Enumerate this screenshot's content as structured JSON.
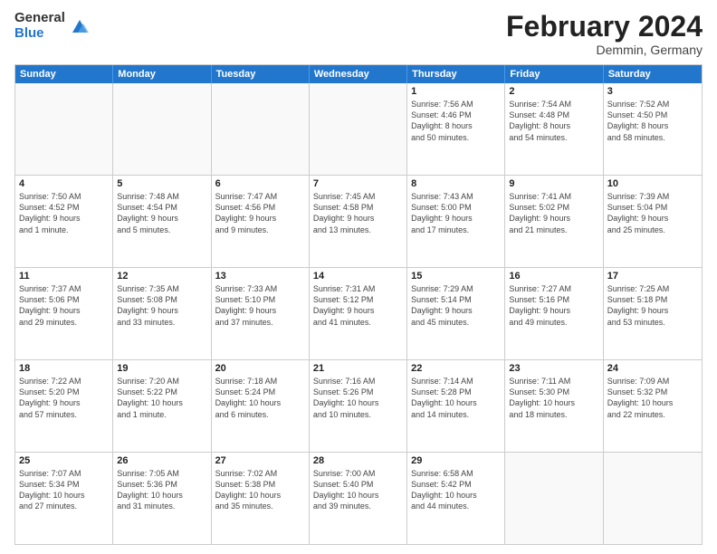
{
  "header": {
    "logo": {
      "general": "General",
      "blue": "Blue"
    },
    "title": "February 2024",
    "location": "Demmin, Germany"
  },
  "weekdays": [
    "Sunday",
    "Monday",
    "Tuesday",
    "Wednesday",
    "Thursday",
    "Friday",
    "Saturday"
  ],
  "rows": [
    [
      {
        "day": "",
        "info": ""
      },
      {
        "day": "",
        "info": ""
      },
      {
        "day": "",
        "info": ""
      },
      {
        "day": "",
        "info": ""
      },
      {
        "day": "1",
        "info": "Sunrise: 7:56 AM\nSunset: 4:46 PM\nDaylight: 8 hours\nand 50 minutes."
      },
      {
        "day": "2",
        "info": "Sunrise: 7:54 AM\nSunset: 4:48 PM\nDaylight: 8 hours\nand 54 minutes."
      },
      {
        "day": "3",
        "info": "Sunrise: 7:52 AM\nSunset: 4:50 PM\nDaylight: 8 hours\nand 58 minutes."
      }
    ],
    [
      {
        "day": "4",
        "info": "Sunrise: 7:50 AM\nSunset: 4:52 PM\nDaylight: 9 hours\nand 1 minute."
      },
      {
        "day": "5",
        "info": "Sunrise: 7:48 AM\nSunset: 4:54 PM\nDaylight: 9 hours\nand 5 minutes."
      },
      {
        "day": "6",
        "info": "Sunrise: 7:47 AM\nSunset: 4:56 PM\nDaylight: 9 hours\nand 9 minutes."
      },
      {
        "day": "7",
        "info": "Sunrise: 7:45 AM\nSunset: 4:58 PM\nDaylight: 9 hours\nand 13 minutes."
      },
      {
        "day": "8",
        "info": "Sunrise: 7:43 AM\nSunset: 5:00 PM\nDaylight: 9 hours\nand 17 minutes."
      },
      {
        "day": "9",
        "info": "Sunrise: 7:41 AM\nSunset: 5:02 PM\nDaylight: 9 hours\nand 21 minutes."
      },
      {
        "day": "10",
        "info": "Sunrise: 7:39 AM\nSunset: 5:04 PM\nDaylight: 9 hours\nand 25 minutes."
      }
    ],
    [
      {
        "day": "11",
        "info": "Sunrise: 7:37 AM\nSunset: 5:06 PM\nDaylight: 9 hours\nand 29 minutes."
      },
      {
        "day": "12",
        "info": "Sunrise: 7:35 AM\nSunset: 5:08 PM\nDaylight: 9 hours\nand 33 minutes."
      },
      {
        "day": "13",
        "info": "Sunrise: 7:33 AM\nSunset: 5:10 PM\nDaylight: 9 hours\nand 37 minutes."
      },
      {
        "day": "14",
        "info": "Sunrise: 7:31 AM\nSunset: 5:12 PM\nDaylight: 9 hours\nand 41 minutes."
      },
      {
        "day": "15",
        "info": "Sunrise: 7:29 AM\nSunset: 5:14 PM\nDaylight: 9 hours\nand 45 minutes."
      },
      {
        "day": "16",
        "info": "Sunrise: 7:27 AM\nSunset: 5:16 PM\nDaylight: 9 hours\nand 49 minutes."
      },
      {
        "day": "17",
        "info": "Sunrise: 7:25 AM\nSunset: 5:18 PM\nDaylight: 9 hours\nand 53 minutes."
      }
    ],
    [
      {
        "day": "18",
        "info": "Sunrise: 7:22 AM\nSunset: 5:20 PM\nDaylight: 9 hours\nand 57 minutes."
      },
      {
        "day": "19",
        "info": "Sunrise: 7:20 AM\nSunset: 5:22 PM\nDaylight: 10 hours\nand 1 minute."
      },
      {
        "day": "20",
        "info": "Sunrise: 7:18 AM\nSunset: 5:24 PM\nDaylight: 10 hours\nand 6 minutes."
      },
      {
        "day": "21",
        "info": "Sunrise: 7:16 AM\nSunset: 5:26 PM\nDaylight: 10 hours\nand 10 minutes."
      },
      {
        "day": "22",
        "info": "Sunrise: 7:14 AM\nSunset: 5:28 PM\nDaylight: 10 hours\nand 14 minutes."
      },
      {
        "day": "23",
        "info": "Sunrise: 7:11 AM\nSunset: 5:30 PM\nDaylight: 10 hours\nand 18 minutes."
      },
      {
        "day": "24",
        "info": "Sunrise: 7:09 AM\nSunset: 5:32 PM\nDaylight: 10 hours\nand 22 minutes."
      }
    ],
    [
      {
        "day": "25",
        "info": "Sunrise: 7:07 AM\nSunset: 5:34 PM\nDaylight: 10 hours\nand 27 minutes."
      },
      {
        "day": "26",
        "info": "Sunrise: 7:05 AM\nSunset: 5:36 PM\nDaylight: 10 hours\nand 31 minutes."
      },
      {
        "day": "27",
        "info": "Sunrise: 7:02 AM\nSunset: 5:38 PM\nDaylight: 10 hours\nand 35 minutes."
      },
      {
        "day": "28",
        "info": "Sunrise: 7:00 AM\nSunset: 5:40 PM\nDaylight: 10 hours\nand 39 minutes."
      },
      {
        "day": "29",
        "info": "Sunrise: 6:58 AM\nSunset: 5:42 PM\nDaylight: 10 hours\nand 44 minutes."
      },
      {
        "day": "",
        "info": ""
      },
      {
        "day": "",
        "info": ""
      }
    ]
  ]
}
